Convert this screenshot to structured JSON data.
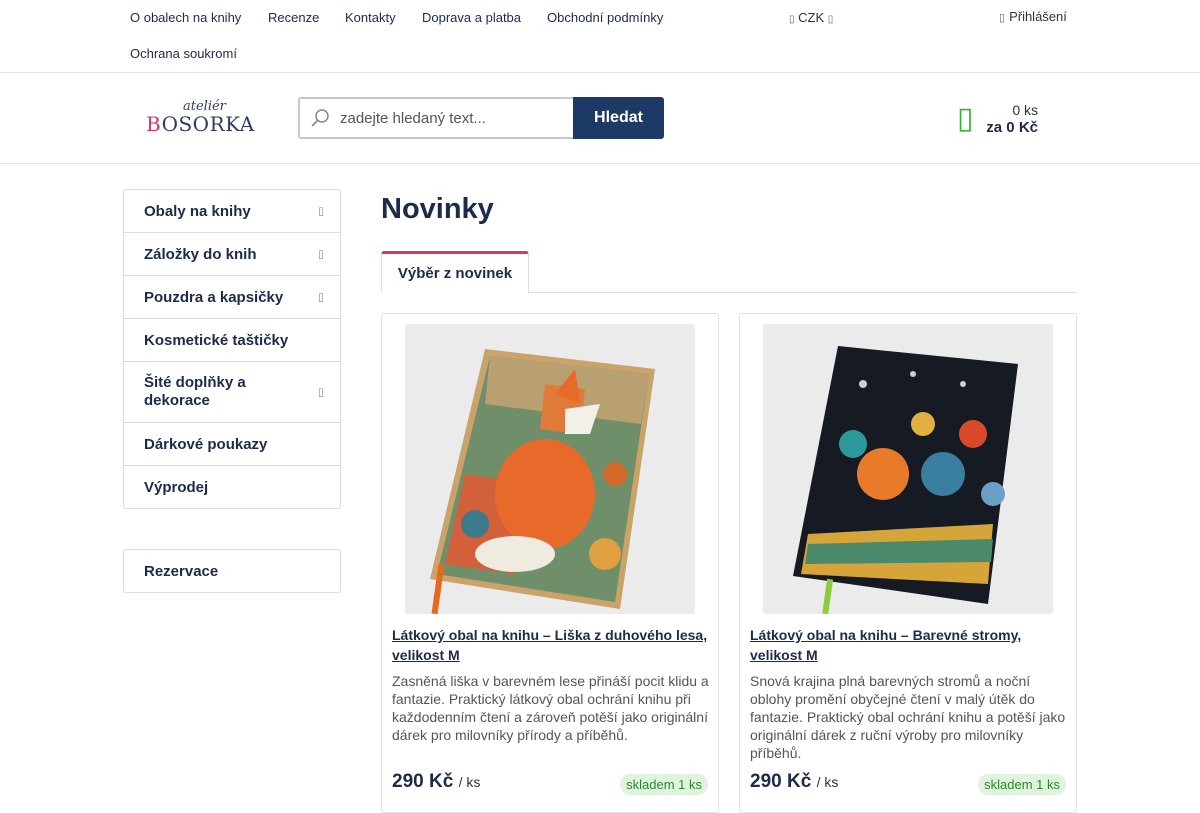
{
  "topnav": {
    "links": [
      "O obalech na knihy",
      "Recenze",
      "Kontakty",
      "Doprava a platba",
      "Obchodní podmínky",
      "Ochrana soukromí"
    ],
    "currency": "CZK",
    "login": "Přihlášení"
  },
  "header": {
    "logo_top": "ateliér",
    "logo_main_first": "B",
    "logo_main_rest": "OSORKA",
    "search_placeholder": "zadejte hledaný text...",
    "search_button": "Hledat",
    "cart_count": "0 ks",
    "cart_total": "za 0 Kč"
  },
  "sidebar": {
    "items": [
      {
        "label": "Obaly na knihy",
        "has_submenu": true
      },
      {
        "label": "Záložky do knih",
        "has_submenu": true
      },
      {
        "label": "Pouzdra a kapsičky",
        "has_submenu": true
      },
      {
        "label": "Kosmetické taštičky",
        "has_submenu": false
      },
      {
        "label": "Šité doplňky a dekorace",
        "has_submenu": true
      },
      {
        "label": "Dárkové poukazy",
        "has_submenu": false
      },
      {
        "label": "Výprodej",
        "has_submenu": false
      }
    ],
    "secondary": "Rezervace"
  },
  "main": {
    "title": "Novinky",
    "tab": "Výběr z novinek",
    "products": [
      {
        "title": "Látkový obal na knihu – Liška z duhového lesa, velikost M",
        "desc": "Zasněná liška v barevném lese přináší pocit klidu a fantazie. Praktický látkový obal ochrání knihu při každodenním čtení a zároveň potěší jako originální dárek pro milovníky přírody a příběhů.",
        "price": "290 Kč",
        "unit": "/ ks",
        "stock": "skladem 1 ks"
      },
      {
        "title": "Látkový obal na knihu – Barevné stromy, velikost M",
        "desc": "Snová krajina plná barevných stromů a noční oblohy promění obyčejné čtení v malý útěk do fantazie. Praktický obal ochrání knihu a potěší jako originální dárek z ruční výroby pro milovníky příběhů.",
        "price": "290 Kč",
        "unit": "/ ks",
        "stock": "skladem 1 ks"
      }
    ]
  },
  "colors": {
    "navy": "#1c2b4a",
    "accent_pink": "#d7356b",
    "button_navy": "#1d3a66",
    "cart_green": "#2eb82e",
    "stock_bg": "#dff3df"
  },
  "icons": {
    "currency": "chevron-down-icon",
    "login": "user-icon",
    "search": "search-icon",
    "cart": "cart-icon",
    "submenu": "chevron-right-icon"
  }
}
